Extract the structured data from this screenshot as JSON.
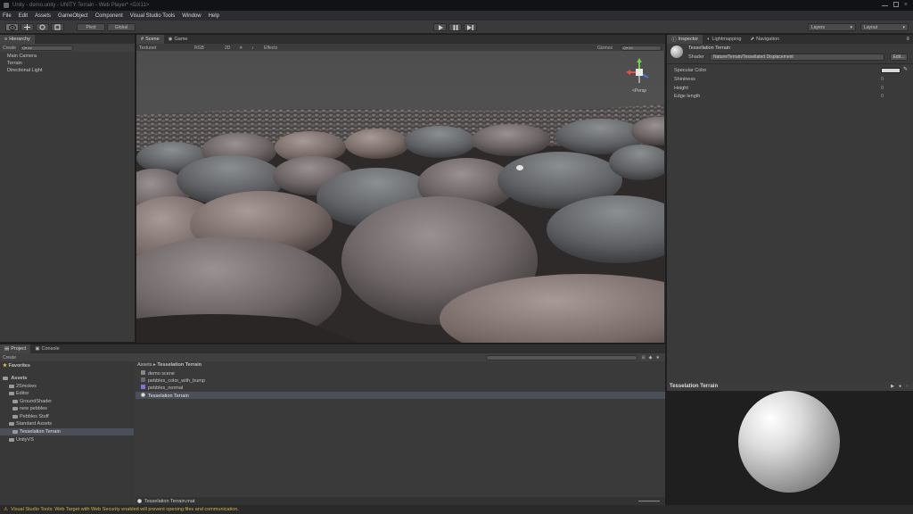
{
  "window": {
    "title": "Unity - demo.unity - UNITY Terrain - Web Player* <DX11>"
  },
  "menu": [
    "File",
    "Edit",
    "Assets",
    "GameObject",
    "Component",
    "Visual Studio Tools",
    "Window",
    "Help"
  ],
  "toolbar": {
    "pivot": "Pivot",
    "global": "Global",
    "layers": "Layers",
    "layout": "Layout"
  },
  "hierarchy": {
    "tab": "Hierarchy",
    "create": "Create",
    "search_placeholder": "Q▾ All",
    "items": [
      "Main Camera",
      "Terrain",
      "Directional Light"
    ]
  },
  "scene": {
    "tabs": [
      "Scene",
      "Game"
    ],
    "shading": "Textured",
    "mode": "RGB",
    "view_2d": "2D",
    "effects": "Effects",
    "gizmos": "Gizmos",
    "search_placeholder": "Q▾ All",
    "gizmo_label": "<Persp"
  },
  "inspector": {
    "tabs": [
      "Inspector",
      "Lightmapping",
      "Navigation"
    ],
    "material_name": "Tessellation Terrain",
    "shader_label": "Shader",
    "shader_value": "Nature/Terrain/Tessellated Displacement",
    "edit": "Edit...",
    "properties": [
      {
        "label": "Specular Color",
        "value": ""
      },
      {
        "label": "Shininess",
        "value": "0"
      },
      {
        "label": "Height",
        "value": "0"
      },
      {
        "label": "Edge length",
        "value": "0"
      }
    ]
  },
  "preview": {
    "title": "Tesselation Terrain"
  },
  "project": {
    "tabs": [
      "Project",
      "Console"
    ],
    "create": "Create",
    "favorites": "Favorites",
    "assets_root": "Assets",
    "folders": [
      "2Smokes",
      "Editor",
      "GroundShader",
      "new pebbles",
      "Pebbles Stuff",
      "Standard Assets",
      "Tesselation Terrain",
      "UnityVS"
    ],
    "breadcrumb": [
      "Assets",
      "Tesselation Terrain"
    ],
    "files": [
      "demo scene",
      "pebbles_color_with_bump",
      "pebbles_normal",
      "Tesselation Terrain"
    ],
    "selected_file": "Tesselation Terrain.mat"
  },
  "status": {
    "message": "Visual Studio Tools: Web Target with Web Security enabled will prevent opening files and communication."
  },
  "colors": {
    "panel": "#3a3a3a",
    "scene_bg": "#505050",
    "status_text": "#d4b24a",
    "selection": "#3d5e8a"
  }
}
